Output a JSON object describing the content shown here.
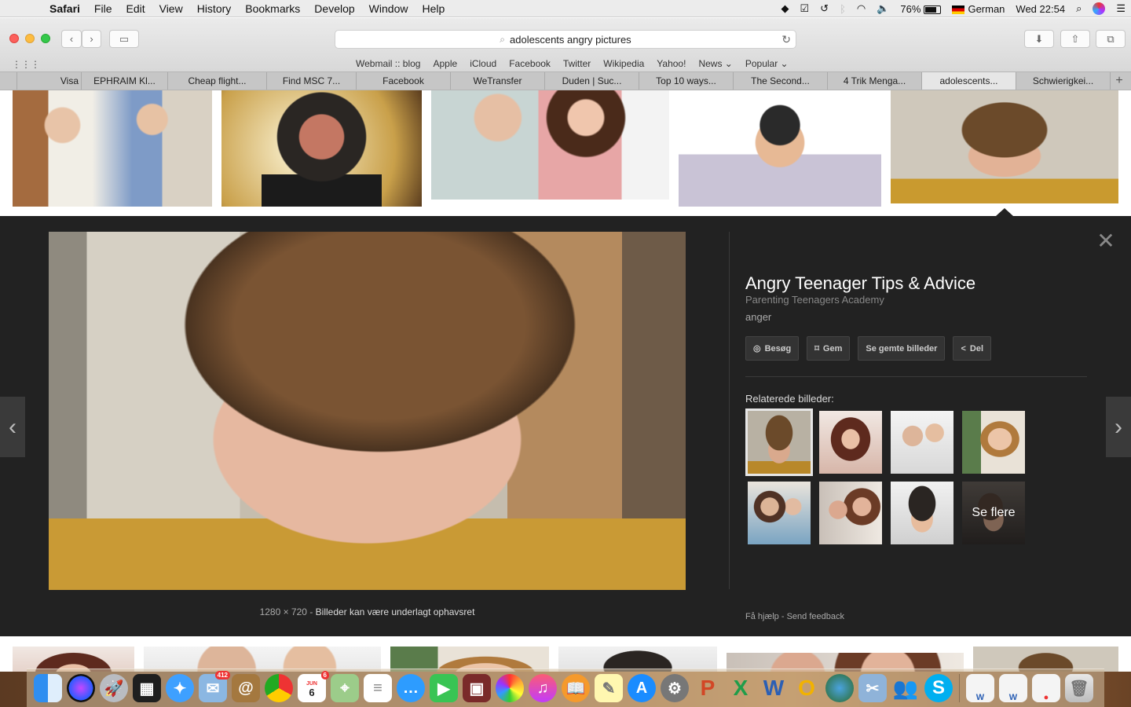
{
  "menubar": {
    "app": "Safari",
    "items": [
      "File",
      "Edit",
      "View",
      "History",
      "Bookmarks",
      "Develop",
      "Window",
      "Help"
    ],
    "battery": "76%",
    "input_source": "German",
    "clock": "Wed 22:54"
  },
  "toolbar": {
    "url": "adolescents angry pictures",
    "favorites": [
      "Webmail :: blog",
      "Apple",
      "iCloud",
      "Facebook",
      "Twitter",
      "Wikipedia",
      "Yahoo!",
      "News ⌄",
      "Popular ⌄"
    ]
  },
  "tabs": [
    "Visa",
    "EPHRAIM Kl...",
    "Cheap flight...",
    "Find MSC 7...",
    "Facebook",
    "WeTransfer",
    "Duden | Suc...",
    "Top 10 ways...",
    "The Second...",
    "4 Trik Menga...",
    "adolescents...",
    "Schwierigkei..."
  ],
  "preview": {
    "title": "Angry Teenager Tips & Advice",
    "source": "Parenting Teenagers Academy",
    "tag": "anger",
    "actions": {
      "visit": "Besøg",
      "save": "Gem",
      "saved": "Se gemte billeder",
      "share": "Del"
    },
    "related_label": "Relaterede billeder:",
    "more_label": "Se flere",
    "dimensions": "1280 × 720",
    "copyright": "Billeder kan være underlagt ophavsret",
    "help": "Få hjælp",
    "feedback": "Send feedback"
  },
  "dock": {
    "mail_badge": "412",
    "calendar_badge": "6",
    "calendar_month": "JUN",
    "calendar_day": "6"
  }
}
